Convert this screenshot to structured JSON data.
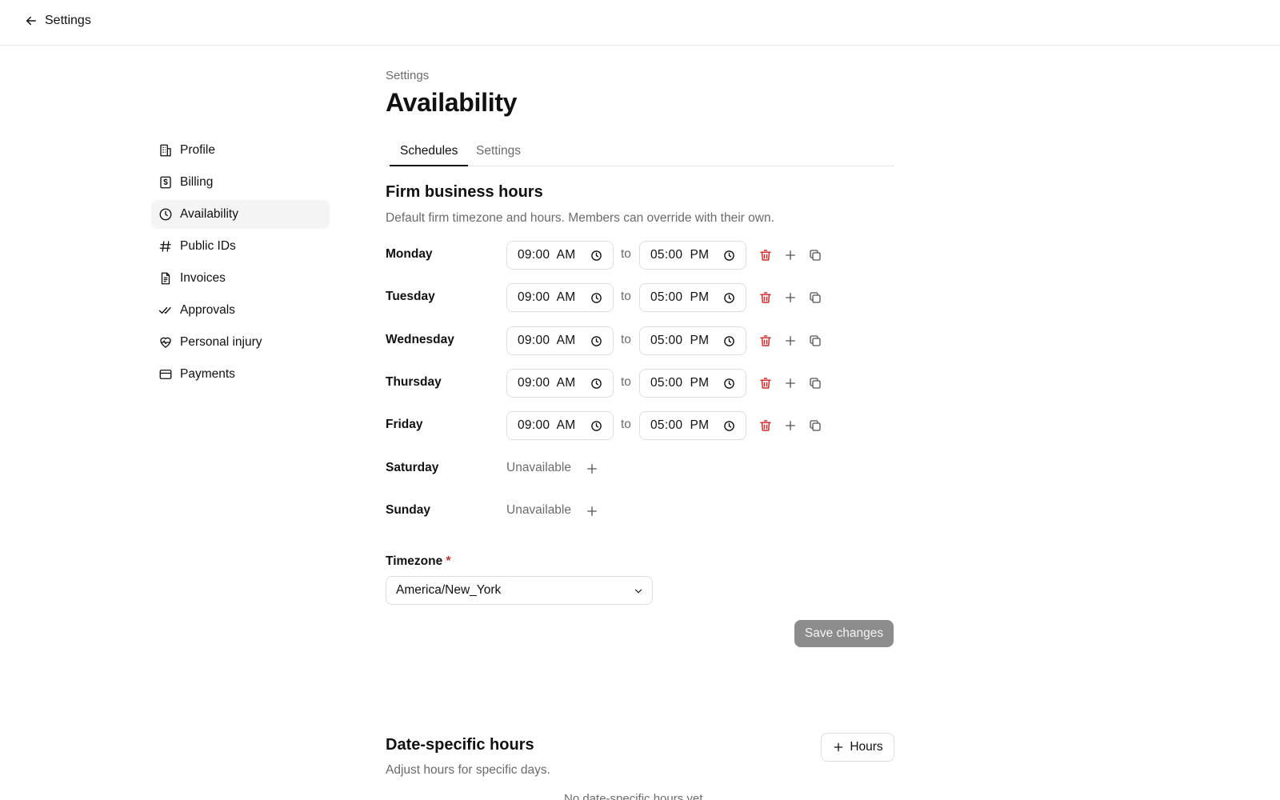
{
  "topbar": {
    "back_label": "Settings"
  },
  "sidebar": {
    "items": [
      {
        "label": "Profile",
        "icon": "building-icon"
      },
      {
        "label": "Billing",
        "icon": "dollar-receipt-icon"
      },
      {
        "label": "Availability",
        "icon": "clock-icon",
        "active": true
      },
      {
        "label": "Public IDs",
        "icon": "hash-icon"
      },
      {
        "label": "Invoices",
        "icon": "document-icon"
      },
      {
        "label": "Approvals",
        "icon": "double-check-icon"
      },
      {
        "label": "Personal injury",
        "icon": "heart-pulse-icon"
      },
      {
        "label": "Payments",
        "icon": "credit-card-icon"
      }
    ]
  },
  "header": {
    "breadcrumb": "Settings",
    "title": "Availability"
  },
  "tabs": [
    {
      "label": "Schedules",
      "active": true
    },
    {
      "label": "Settings",
      "active": false
    }
  ],
  "business_hours": {
    "title": "Firm business hours",
    "description": "Default firm timezone and hours. Members can override with their own.",
    "to_label": "to",
    "unavailable_label": "Unavailable",
    "days": [
      {
        "name": "Monday",
        "start": "09:00  AM",
        "end": "05:00  PM"
      },
      {
        "name": "Tuesday",
        "start": "09:00  AM",
        "end": "05:00  PM"
      },
      {
        "name": "Wednesday",
        "start": "09:00  AM",
        "end": "05:00  PM"
      },
      {
        "name": "Thursday",
        "start": "09:00  AM",
        "end": "05:00  PM"
      },
      {
        "name": "Friday",
        "start": "09:00  AM",
        "end": "05:00  PM"
      },
      {
        "name": "Saturday",
        "available": false
      },
      {
        "name": "Sunday",
        "available": false
      }
    ]
  },
  "timezone": {
    "label": "Timezone",
    "required_mark": "*",
    "value": "America/New_York"
  },
  "save_label": "Save changes",
  "date_specific": {
    "title": "Date-specific hours",
    "description": "Adjust hours for specific days.",
    "add_label": "Hours",
    "empty_text": "No date-specific hours yet."
  },
  "colors": {
    "danger": "#d22b2b",
    "muted": "#6b6b6b",
    "active_bg": "#f4f4f4",
    "save_bg": "#8c8c8c"
  }
}
